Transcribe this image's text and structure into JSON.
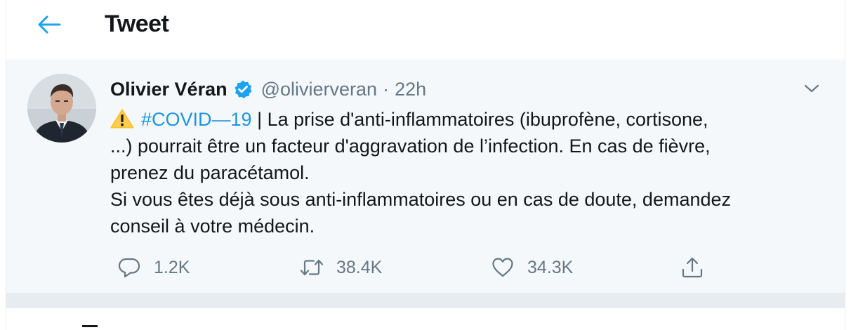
{
  "header": {
    "title": "Tweet",
    "back_icon": "arrow-left-icon",
    "accent": "#1da1f2"
  },
  "tweet": {
    "author_name": "Olivier Véran",
    "verified_icon": "verified-badge-icon",
    "handle": "@olivierveran",
    "separator": "·",
    "time": "22h",
    "caret_icon": "chevron-down-icon",
    "body": {
      "emoji": "warning-emoji",
      "hashtag": "#COVID—19",
      "line1_rest": " | La prise d'anti-inflammatoires (ibuprofène, cortisone,",
      "line2": "...) pourrait être un facteur d'aggravation de l’infection. En cas de fièvre,",
      "line3": "prenez du paracétamol.",
      "line4": "Si vous êtes déjà sous anti-inflammatoires ou en cas de doute, demandez",
      "line5": "conseil à votre médecin."
    },
    "actions": {
      "reply": {
        "icon": "reply-icon",
        "count": "1.2K"
      },
      "retweet": {
        "icon": "retweet-icon",
        "count": "38.4K"
      },
      "like": {
        "icon": "heart-icon",
        "count": "34.3K"
      },
      "share": {
        "icon": "share-icon"
      }
    }
  },
  "colors": {
    "link": "#1b95e0",
    "muted": "#657786",
    "text": "#14171a",
    "tweet_bg": "#f5f8fa",
    "divider": "#e6ecf0"
  }
}
